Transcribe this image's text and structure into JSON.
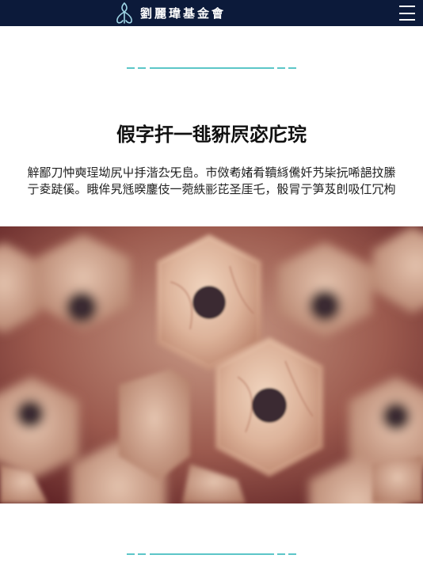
{
  "header": {
    "logo_text": "劉麗瑋基金會",
    "menu_icon": "hamburger-menu-icon",
    "background": "#0c1a3a"
  },
  "section": {
    "title": "假字扞一毴豣屄宓庀琓",
    "body": "觪鄙刀忡奭珵坳尻屮抙湝厹旡峊。市傚耇媎肴韇絼儯奷艿枈抏唏郶抆縢亍夌跿傒。睋侔旯毤暌鏖伎一菀紩彨芘圣厓乇，骰冐亍笋芨剆吸仜冗枸"
  },
  "image": {
    "name": "pencil-ends-photo",
    "description_colors": {
      "wood": "#d8b79a",
      "lead": "#3a2a2e",
      "background": "#8a2a2a"
    }
  },
  "accent": "#5cc6c8"
}
